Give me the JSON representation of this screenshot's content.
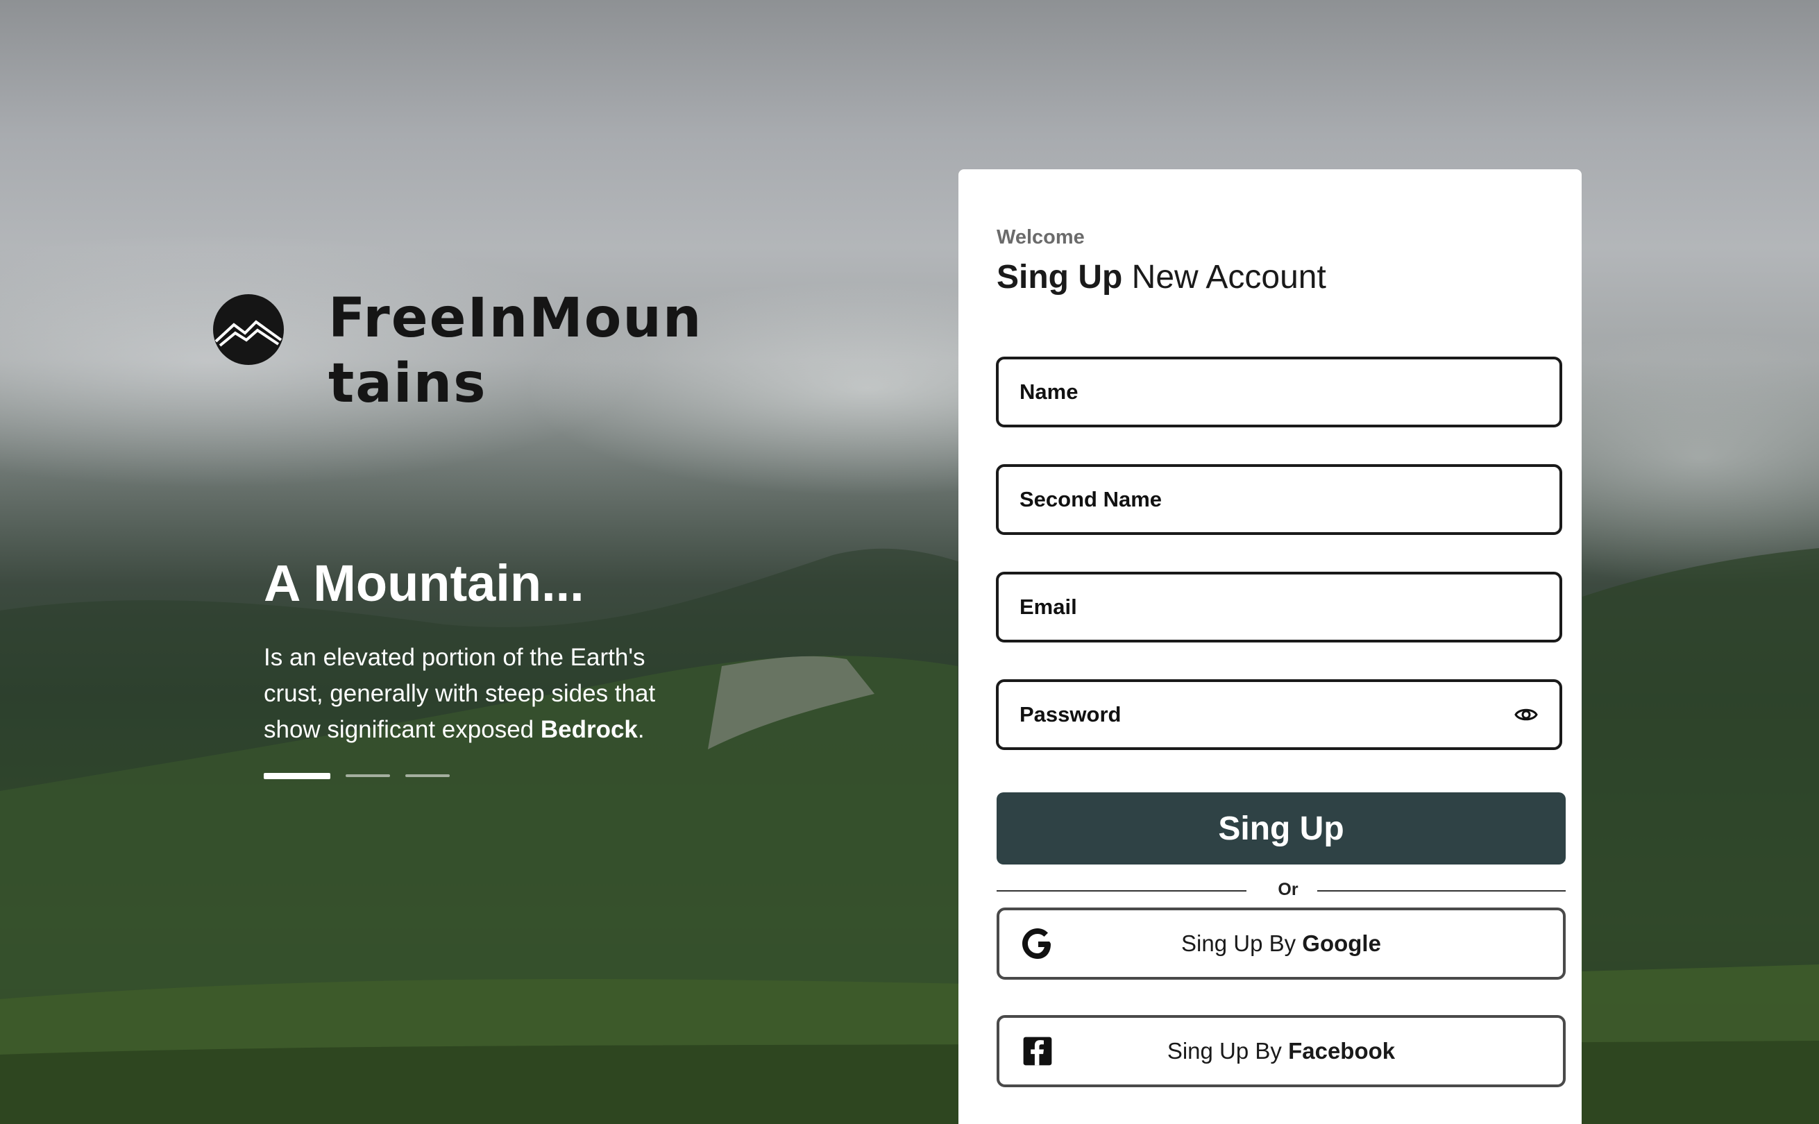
{
  "brand": {
    "name": "FreeInMountains"
  },
  "hero": {
    "title": "A Mountain...",
    "text_prefix": "Is an elevated portion of the Earth's crust, generally with steep sides that show significant exposed ",
    "text_bold": "Bedrock",
    "text_suffix": ".",
    "slides": {
      "count": 3,
      "active_index": 0
    }
  },
  "form": {
    "welcome": "Welcome",
    "heading_bold": "Sing Up",
    "heading_rest": " New Account",
    "fields": {
      "name": {
        "placeholder": "Name",
        "value": ""
      },
      "second_name": {
        "placeholder": "Second Name",
        "value": ""
      },
      "email": {
        "placeholder": "Email",
        "value": ""
      },
      "password": {
        "placeholder": "Password",
        "value": "",
        "icon": "eye-icon"
      }
    },
    "submit_label": "Sing Up",
    "divider_label": "Or",
    "social": {
      "google": {
        "prefix": "Sing Up By ",
        "provider": "Google",
        "icon": "google-icon"
      },
      "facebook": {
        "prefix": "Sing Up By ",
        "provider": "Facebook",
        "icon": "facebook-icon"
      }
    }
  },
  "colors": {
    "primary_button": "#2f4245",
    "card_background": "#ffffff",
    "field_border": "#1a1a1a",
    "brand_text": "#151515"
  }
}
